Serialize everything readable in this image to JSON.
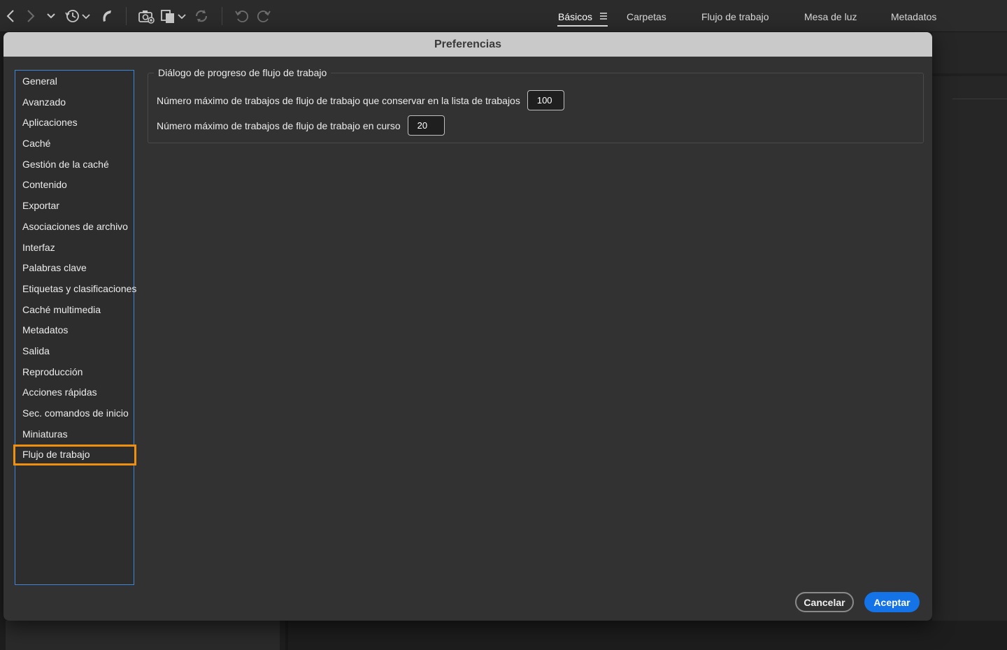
{
  "toolbar": {
    "icons": [
      "back-arrow-icon",
      "forward-arrow-icon",
      "recent-chevron-icon",
      "history-clock-icon",
      "boomerang-icon",
      "camera-import-icon",
      "copy-files-icon",
      "refresh-icon",
      "undo-icon",
      "redo-icon"
    ]
  },
  "workspaces": {
    "tabs": [
      {
        "label": "Básicos",
        "active": true
      },
      {
        "label": "Carpetas"
      },
      {
        "label": "Flujo de trabajo"
      },
      {
        "label": "Mesa de luz"
      },
      {
        "label": "Metadatos"
      }
    ]
  },
  "dialog": {
    "title": "Preferencias",
    "categories": [
      "General",
      "Avanzado",
      "Aplicaciones",
      "Caché",
      "Gestión de la caché",
      "Contenido",
      "Exportar",
      "Asociaciones de archivo",
      "Interfaz",
      "Palabras clave",
      "Etiquetas y clasificaciones",
      "Caché multimedia",
      "Metadatos",
      "Salida",
      "Reproducción",
      "Acciones rápidas",
      "Sec. comandos de inicio",
      "Miniaturas",
      "Flujo de trabajo"
    ],
    "selected_category": "Flujo de trabajo",
    "section": {
      "legend": "Diálogo de progreso de flujo de trabajo",
      "fields": [
        {
          "label": "Número máximo de trabajos de flujo de trabajo que conservar en la lista de trabajos",
          "value": "100"
        },
        {
          "label": "Número máximo de trabajos de flujo de trabajo en curso",
          "value": "20"
        }
      ]
    },
    "buttons": {
      "cancel": "Cancelar",
      "ok": "Aceptar"
    },
    "colors": {
      "selection_highlight": "#f0900f",
      "list_border": "#3b86d8",
      "primary_button": "#1473e6"
    }
  }
}
